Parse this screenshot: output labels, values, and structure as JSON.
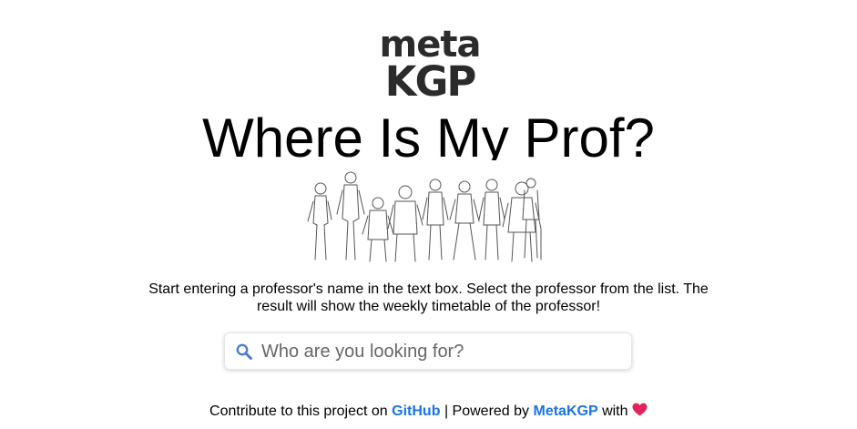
{
  "logo": {
    "line1": "meta",
    "line2": "KGP"
  },
  "title": "Where Is My Prof?",
  "description": "Start entering a professor's name in the text box. Select the professor from the list. The result will show the weekly timetable of the professor!",
  "search": {
    "placeholder": "Who are you looking for?",
    "value": "",
    "icon": "search-icon",
    "icon_color": "#4a7bd0"
  },
  "footer": {
    "prefix": "Contribute to this project on",
    "github_label": "GitHub",
    "middle": "| Powered by",
    "metakgp_label": "MetaKGP",
    "suffix": "with",
    "heart_icon": "heart-icon",
    "link_color": "#1a73e8",
    "heart_color": "#e0245e"
  }
}
